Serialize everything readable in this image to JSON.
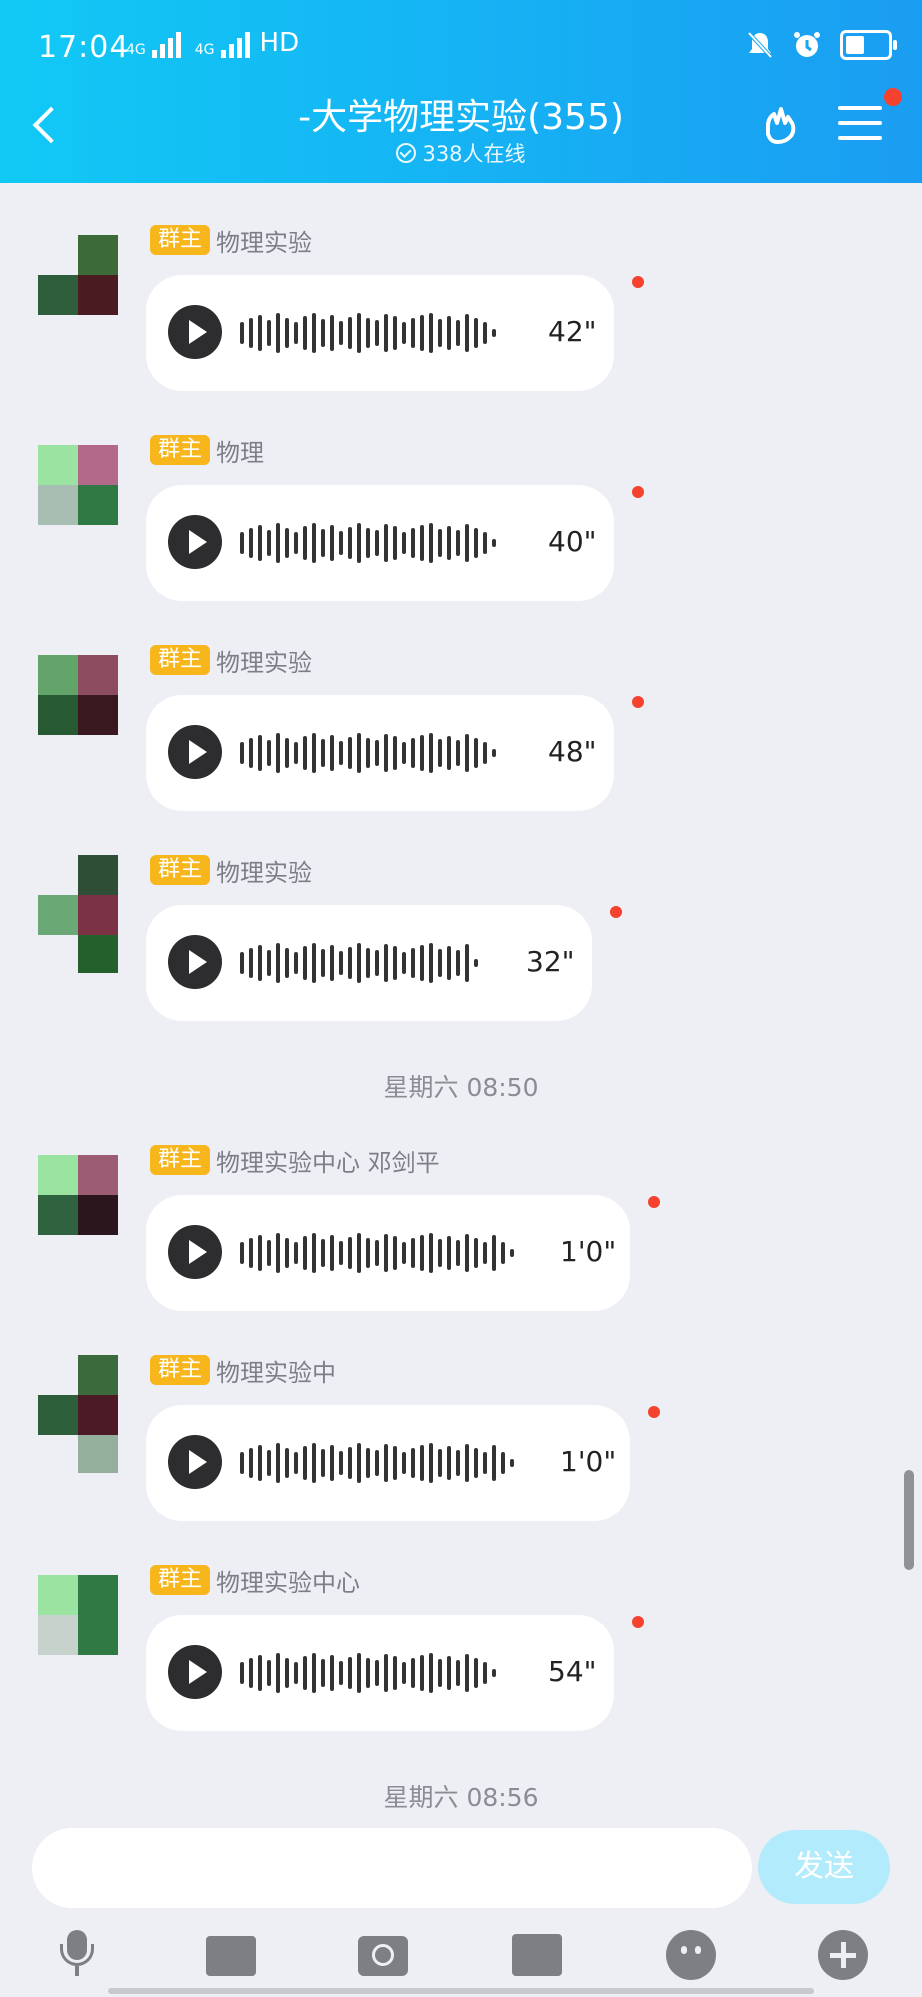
{
  "status_bar": {
    "time": "17:04",
    "network_1": "4G",
    "network_2": "4G",
    "hd_label": "HD"
  },
  "header": {
    "title": "-大学物理实验(355)",
    "online": "338人在线"
  },
  "badge_label": "群主",
  "messages": [
    {
      "sender": "物理实验",
      "duration": "42\""
    },
    {
      "sender": "物理",
      "duration": "40\""
    },
    {
      "sender": "物理实验",
      "duration": "48\""
    },
    {
      "sender": "物理实验",
      "duration": "32\""
    },
    {
      "sender": "物理实验中心 邓剑平",
      "duration": "1'0\""
    },
    {
      "sender": "物理实验中",
      "duration": "1'0\""
    },
    {
      "sender": "物理实验中心",
      "duration": "54\""
    }
  ],
  "dividers": [
    "星期六 08:50",
    "星期六 08:56"
  ],
  "input": {
    "placeholder": "",
    "send_label": "发送"
  },
  "colors": {
    "header_start": "#11c9f5",
    "header_end": "#1a9df2",
    "badge": "#f7b61b",
    "unread_dot": "#f5422f",
    "background": "#edeff4"
  },
  "toolbar": [
    "microphone-icon",
    "image-icon",
    "camera-icon",
    "gift-icon",
    "emoji-icon",
    "plus-icon"
  ]
}
